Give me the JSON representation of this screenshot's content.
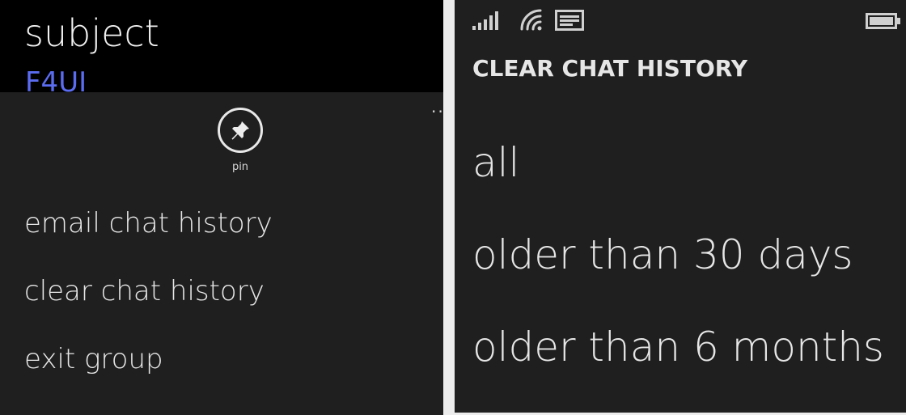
{
  "left_screen": {
    "header": {
      "title": "subject",
      "group_name": "F4UI"
    },
    "more_indicator": "..",
    "pin_action": {
      "icon": "pin-icon",
      "label": "pin"
    },
    "menu_items": [
      {
        "label": "email chat history"
      },
      {
        "label": "clear chat history"
      },
      {
        "label": "exit group"
      }
    ]
  },
  "right_screen": {
    "status_bar": {
      "icons": [
        "signal-icon",
        "wifi-icon",
        "message-icon",
        "battery-icon"
      ]
    },
    "dialog_title": "CLEAR CHAT HISTORY",
    "options": [
      {
        "label": "all"
      },
      {
        "label": "older than 30 days"
      },
      {
        "label": "older than 6 months"
      }
    ]
  },
  "colors": {
    "background": "#1f1f1f",
    "header_background": "#000000",
    "accent": "#5b6cf0",
    "text": "#e6e6e6"
  }
}
